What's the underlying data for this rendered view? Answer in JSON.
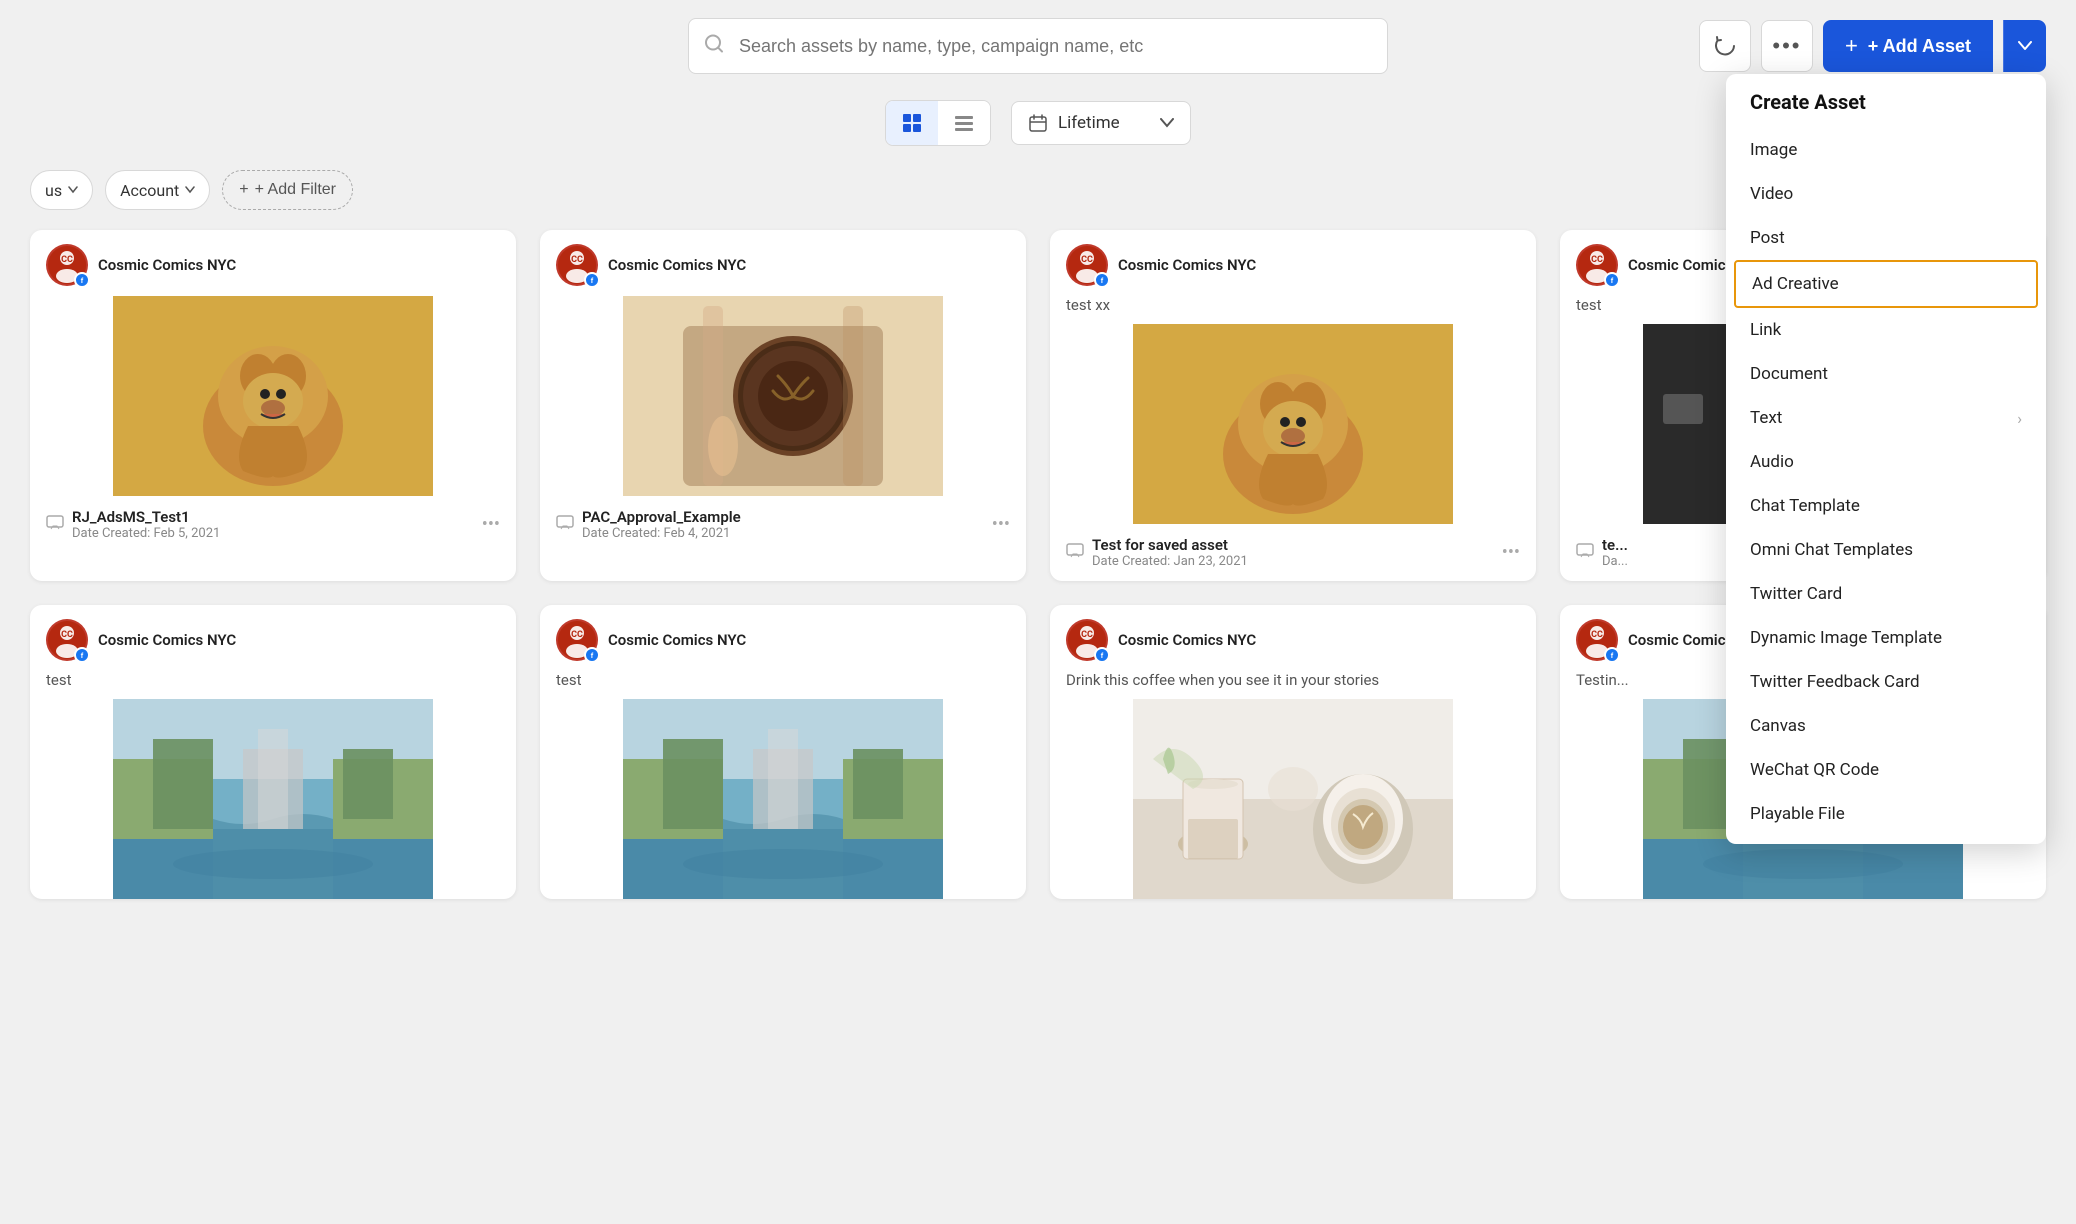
{
  "search": {
    "placeholder": "Search assets by name, type, campaign name, etc"
  },
  "toolbar": {
    "refresh_label": "↻",
    "more_label": "•••",
    "add_asset_label": "+ Add Asset",
    "dropdown_arrow": "▾"
  },
  "view_controls": {
    "grid_label": "⊞",
    "list_label": "☰",
    "lifetime_label": "Lifetime",
    "calendar_icon": "📅"
  },
  "filters": [
    {
      "label": "Account",
      "has_dropdown": true
    },
    {
      "label": "+ Add Filter",
      "is_add": true
    }
  ],
  "dropdown_menu": {
    "title": "Create Asset",
    "items": [
      {
        "label": "Image",
        "has_arrow": false,
        "highlighted": false
      },
      {
        "label": "Video",
        "has_arrow": false,
        "highlighted": false
      },
      {
        "label": "Post",
        "has_arrow": false,
        "highlighted": false
      },
      {
        "label": "Ad Creative",
        "has_arrow": false,
        "highlighted": true
      },
      {
        "label": "Link",
        "has_arrow": false,
        "highlighted": false
      },
      {
        "label": "Document",
        "has_arrow": false,
        "highlighted": false
      },
      {
        "label": "Text",
        "has_arrow": true,
        "highlighted": false
      },
      {
        "label": "Audio",
        "has_arrow": false,
        "highlighted": false
      },
      {
        "label": "Chat Template",
        "has_arrow": false,
        "highlighted": false
      },
      {
        "label": "Omni Chat Templates",
        "has_arrow": false,
        "highlighted": false
      },
      {
        "label": "Twitter Card",
        "has_arrow": false,
        "highlighted": false
      },
      {
        "label": "Dynamic Image Template",
        "has_arrow": false,
        "highlighted": false
      },
      {
        "label": "Twitter Feedback Card",
        "has_arrow": false,
        "highlighted": false
      },
      {
        "label": "Canvas",
        "has_arrow": false,
        "highlighted": false
      },
      {
        "label": "WeChat QR Code",
        "has_arrow": false,
        "highlighted": false
      },
      {
        "label": "Playable File",
        "has_arrow": false,
        "highlighted": false
      }
    ]
  },
  "asset_cards": [
    {
      "brand": "Cosmic Comics NYC",
      "title": "",
      "name": "RJ_AdsMS_Test1",
      "date": "Date Created: Feb 5, 2021",
      "image_type": "dog"
    },
    {
      "brand": "Cosmic Comics NYC",
      "title": "",
      "name": "PAC_Approval_Example",
      "date": "Date Created: Feb 4, 2021",
      "image_type": "coffee"
    },
    {
      "brand": "Cosmic Comics NYC",
      "title": "test xx",
      "name": "Test for saved asset",
      "date": "Date Created: Jan 23, 2021",
      "image_type": "dog"
    },
    {
      "brand": "Cosmic Comics NYC",
      "title": "test",
      "name": "te...",
      "date": "Da...",
      "image_type": "camera"
    },
    {
      "brand": "Cosmic Comics NYC",
      "title": "test",
      "name": "",
      "date": "",
      "image_type": "river"
    },
    {
      "brand": "Cosmic Comics NYC",
      "title": "test",
      "name": "",
      "date": "",
      "image_type": "river"
    },
    {
      "brand": "Cosmic Comics NYC",
      "title": "Drink this coffee when you see it in your stories",
      "name": "",
      "date": "",
      "image_type": "coffee2"
    },
    {
      "brand": "Cosmic Comics NYC",
      "title": "Testin...",
      "name": "",
      "date": "",
      "image_type": "river"
    }
  ],
  "colors": {
    "brand_blue": "#1a56db",
    "highlighted_border": "#e8960a",
    "bg_gray": "#f0f0f0"
  }
}
